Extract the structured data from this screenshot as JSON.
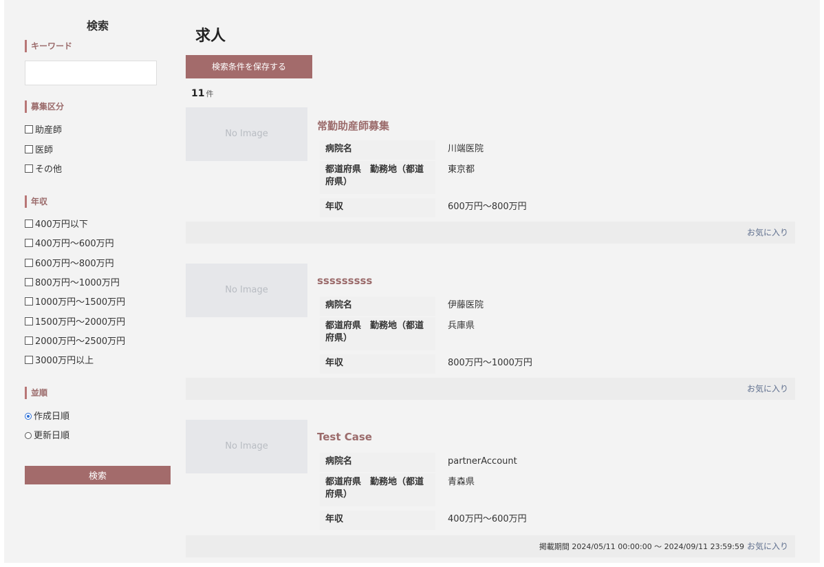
{
  "sidebar": {
    "title": "検索",
    "keyword_label": "キーワード",
    "keyword_value": "",
    "category_label": "募集区分",
    "categories": [
      "助産師",
      "医師",
      "その他"
    ],
    "income_label": "年収",
    "incomes": [
      "400万円以下",
      "400万円〜600万円",
      "600万円〜800万円",
      "800万円〜1000万円",
      "1000万円〜1500万円",
      "1500万円〜2000万円",
      "2000万円〜2500万円",
      "3000万円以上"
    ],
    "sort_label": "並順",
    "sorts": [
      "作成日順",
      "更新日順"
    ],
    "sort_selected": "作成日順",
    "search_button": "検索"
  },
  "main": {
    "title": "求人",
    "save_button": "検索条件を保存する",
    "count": "11",
    "count_unit": "件",
    "no_image": "No Image",
    "favorite_label": "お気に入り",
    "jobs": [
      {
        "title": "常勤助産師募集",
        "rows": [
          {
            "key": "病院名",
            "value": "川端医院"
          },
          {
            "key": "都道府県　勤務地（都道府県）",
            "value": "東京都"
          },
          {
            "key": "年収",
            "value": "600万円〜800万円"
          }
        ],
        "period": ""
      },
      {
        "title": "sssssssss",
        "rows": [
          {
            "key": "病院名",
            "value": "伊藤医院"
          },
          {
            "key": "都道府県　勤務地（都道府県）",
            "value": "兵庫県"
          },
          {
            "key": "年収",
            "value": "800万円〜1000万円"
          }
        ],
        "period": ""
      },
      {
        "title": "Test Case",
        "rows": [
          {
            "key": "病院名",
            "value": "partnerAccount"
          },
          {
            "key": "都道府県　勤務地（都道府県）",
            "value": "青森県"
          },
          {
            "key": "年収",
            "value": "400万円〜600万円"
          }
        ],
        "period": "掲載期間 2024/05/11 00:00:00 〜 2024/09/11 23:59:59"
      }
    ]
  }
}
